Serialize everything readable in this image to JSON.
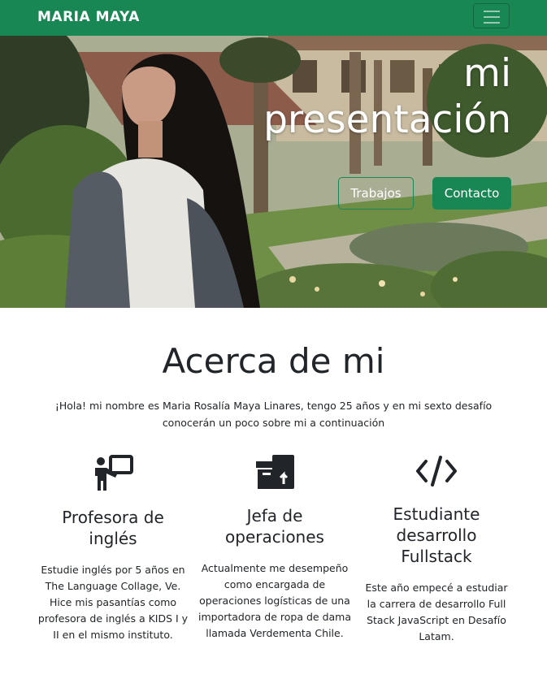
{
  "navbar": {
    "brand": "MARIA MAYA",
    "menu_icon": "hamburger-menu-icon",
    "bg_color": "#198754"
  },
  "hero": {
    "title_line1": "mi",
    "title_line2": "presentación",
    "buttons": {
      "works": "Trabajos",
      "contact": "Contacto"
    }
  },
  "about": {
    "title": "Acerca de mi",
    "intro": "¡Hola! mi nombre es Maria Rosalía Maya Linares, tengo 25 años y en mi sexto desafío conocerán un poco sobre mi a continuación",
    "features": [
      {
        "icon": "teacher-icon",
        "title": "Profesora de inglés",
        "text": "Estudie inglés por 5 años en The Language Collage, Ve. Hice mis pasantías como profesora de inglés a KIDS I y II en el mismo instituto."
      },
      {
        "icon": "box-arrow-icon",
        "title": "Jefa de operaciones",
        "text": "Actualmente me desempeño como encargada de operaciones logísticas de una importadora de ropa de dama llamada Verdementa Chile."
      },
      {
        "icon": "code-icon",
        "title": "Estudiante desarrollo Fullstack",
        "text": "Este año empecé a estudiar la carrera de desarrollo Full Stack JavaScript en Desafío Latam."
      }
    ]
  }
}
